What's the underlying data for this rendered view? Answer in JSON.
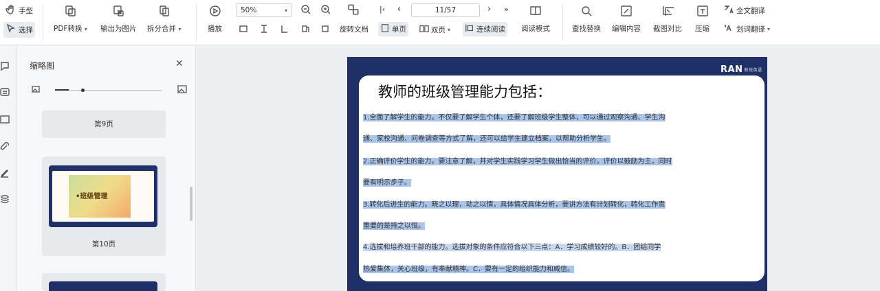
{
  "toolbar": {
    "hand_label": "手型",
    "select_label": "选择",
    "pdf_convert_label": "PDF转换",
    "export_image_label": "输出为图片",
    "split_merge_label": "拆分合并",
    "play_label": "播放",
    "zoom_value": "50%",
    "page_indicator": "11/57",
    "rotate_label": "旋转文档",
    "single_page_label": "单页",
    "double_page_label": "双页",
    "continuous_label": "连续阅读",
    "reading_mode_label": "阅读模式",
    "find_replace_label": "查找替换",
    "edit_content_label": "编辑内容",
    "compare_label": "截图对比",
    "compress_label": "压缩",
    "full_translate_label": "全文翻译",
    "translate_label": "划词翻译"
  },
  "panel": {
    "title": "缩略图",
    "thumbs": [
      {
        "label": "第9页"
      },
      {
        "label": "第10页",
        "slide_title": "•班级管理"
      }
    ]
  },
  "slide": {
    "logo": "RAN",
    "logo_sub": "新锐英语",
    "heading": "教师的班级管理能力包括：",
    "lines": [
      "1.全面了解学生的能力。不仅要了解学生个体，还要了解班级学生整体，可以通过观察沟通、学生沟",
      "通、家校沟通、问卷调查等方式了解，还可以给学生建立档案，以帮助分析学生。",
      "2.正确评价学生的能力。要注意了解，并对学生实践学习学生做出恰当的评价，评价以鼓励为主，同时",
      "要有明示步子。",
      "3.转化后进生的能力。晓之以理，动之以情，具体情况具体分析，要讲方法有计划转化，转化工作贵",
      "重要的是持之以恒。",
      "4.选拔和培养班干部的能力。选拔对象的条件应符合以下三点：A．学习成绩较好的。B．团结同学",
      "热爱集体，关心班级，有奉献精神。C．要有一定的组织能力和威信。"
    ]
  },
  "colors": {
    "slide_bg": "#1f2f68",
    "highlight": "#aac4ea"
  }
}
